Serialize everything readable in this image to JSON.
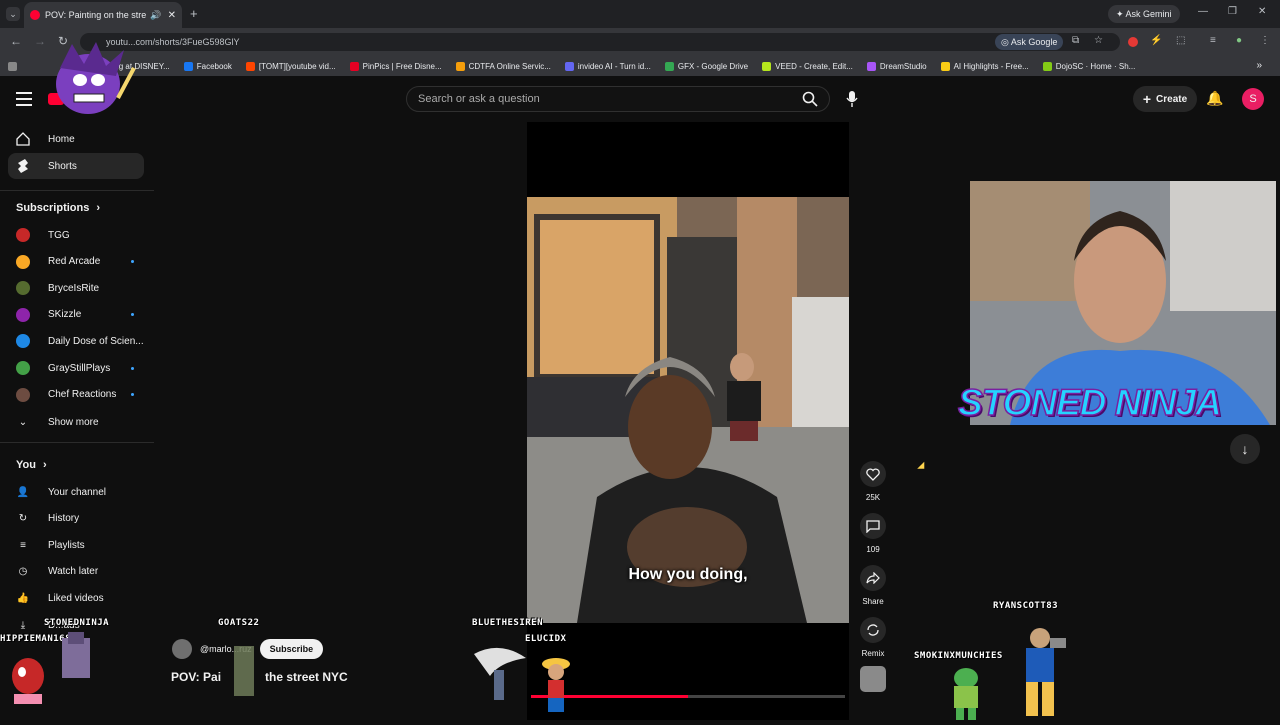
{
  "browser": {
    "tab_title": "POV: Painting on the street",
    "url": "youtu...com/shorts/3FueG598GlY",
    "ask_gemini": "Ask Gemini",
    "ask_google": "Ask Google",
    "bookmarks": [
      "Working at DISNEY...",
      "Facebook",
      "[TOMT][youtube vid...",
      "PinPics | Free Disne...",
      "CDTFA Online Servic...",
      "invideo AI - Turn id...",
      "GFX - Google Drive",
      "VEED - Create, Edit...",
      "DreamStudio",
      "AI Highlights - Free...",
      "DojoSC · Home · Sh..."
    ],
    "bookmark_colors": [
      "#888888",
      "#1877f2",
      "#ff4500",
      "#e60023",
      "#f59e0b",
      "#6366f1",
      "#34a853",
      "#b5e61d",
      "#a855f7",
      "#facc15",
      "#84cc16"
    ]
  },
  "header": {
    "search_placeholder": "Search or ask a question",
    "create_label": "Create",
    "avatar_letter": "S"
  },
  "sidebar": {
    "home": "Home",
    "shorts": "Shorts",
    "subscriptions_title": "Subscriptions",
    "subscriptions": [
      {
        "name": "TGG",
        "color": "#c62828",
        "dot": false
      },
      {
        "name": "Red Arcade",
        "color": "#f9a825",
        "dot": true
      },
      {
        "name": "BryceIsRite",
        "color": "#556b2f",
        "dot": false
      },
      {
        "name": "SKizzle",
        "color": "#8e24aa",
        "dot": true
      },
      {
        "name": "Daily Dose of Scien...",
        "color": "#1e88e5",
        "dot": false
      },
      {
        "name": "GrayStillPlays",
        "color": "#43a047",
        "dot": true
      },
      {
        "name": "Chef Reactions",
        "color": "#6d4c41",
        "dot": true
      }
    ],
    "show_more": "Show more",
    "you_title": "You",
    "you_items": [
      "Your channel",
      "History",
      "Playlists",
      "Watch later",
      "Liked videos",
      "D...ads"
    ]
  },
  "short": {
    "caption": "How you doing,",
    "channel_handle": "@marlo...ruz",
    "subscribe_label": "Subscribe",
    "title_left": "POV: Pai",
    "title_right": "the street NYC",
    "likes": "25K",
    "comments": "109",
    "share_label": "Share",
    "remix_label": "Remix",
    "progress_fraction": 0.5
  },
  "overlays": {
    "streamer_banner": "STONED NINJA",
    "usernames": [
      "GOATS22",
      "STONEDNINJA",
      "HIPPIEMAN1688",
      "BLUETHESIREN",
      "ELUCIDX",
      "RYANSCOTT83",
      "SMOKINXMUNCHIES"
    ]
  }
}
